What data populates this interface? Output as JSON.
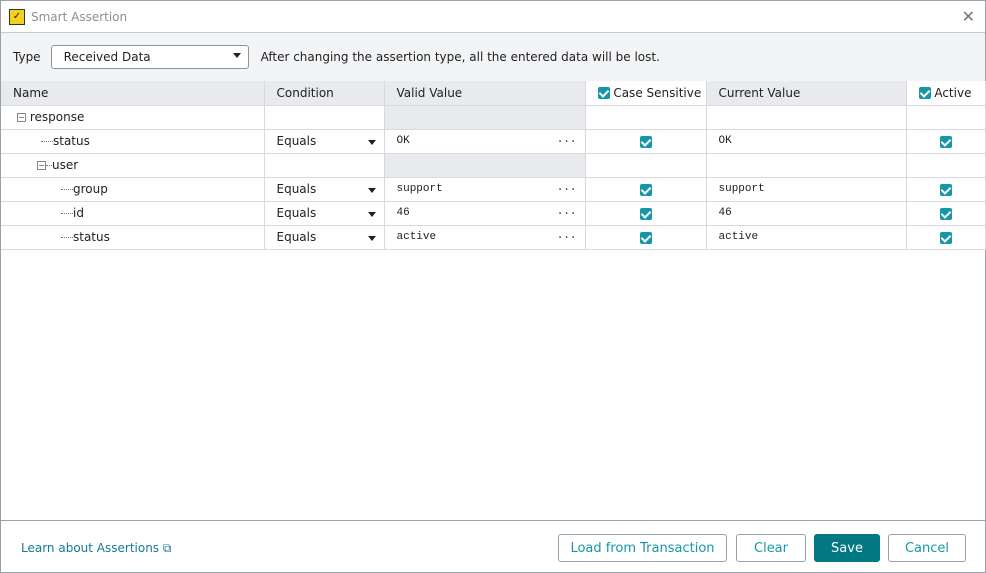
{
  "window": {
    "title": "Smart Assertion",
    "logo_text": "✓"
  },
  "toolbar": {
    "type_label": "Type",
    "type_value": "Received Data",
    "hint": "After changing the assertion type, all the entered data will be lost."
  },
  "columns": {
    "name": "Name",
    "condition": "Condition",
    "valid": "Valid Value",
    "case": "Case Sensitive",
    "current": "Current Value",
    "active": "Active"
  },
  "rows": [
    {
      "name": "response",
      "level": 0,
      "group": true
    },
    {
      "name": "status",
      "level": 1,
      "condition": "Equals",
      "valid": "OK",
      "current": "OK"
    },
    {
      "name": "user",
      "level": 1,
      "group": true
    },
    {
      "name": "group",
      "level": 2,
      "condition": "Equals",
      "valid": "support",
      "current": "support"
    },
    {
      "name": "id",
      "level": 2,
      "condition": "Equals",
      "valid": "46",
      "current": "46"
    },
    {
      "name": "status",
      "level": 2,
      "condition": "Equals",
      "valid": "active",
      "current": "active"
    }
  ],
  "footer": {
    "learn": "Learn about Assertions",
    "load": "Load from Transaction",
    "clear": "Clear",
    "save": "Save",
    "cancel": "Cancel"
  },
  "colors": {
    "accent": "#1597a8",
    "primary": "#017882"
  }
}
